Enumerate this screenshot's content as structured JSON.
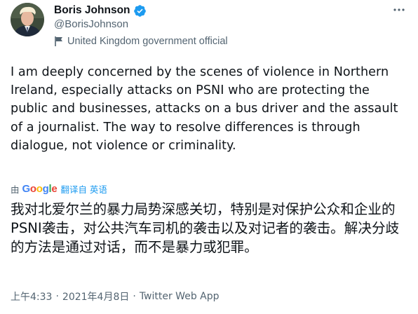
{
  "author": {
    "display_name": "Boris Johnson",
    "handle": "@BorisJohnson",
    "label": "United Kingdom government official",
    "avatar_icon": "profile-photo",
    "verified_icon": "verified-badge-icon",
    "label_icon": "flag-icon"
  },
  "tweet": {
    "text": "I am deeply concerned by the scenes of violence in Northern Ireland, especially attacks on PSNI who are protecting the public and businesses, attacks on a bus driver and the assault of a journalist. The way to resolve differences is through dialogue, not violence or criminality."
  },
  "translation": {
    "by": "由",
    "provider": "Google",
    "link": "翻译自 英语",
    "text": "我对北爱尔兰的暴力局势深感关切，特别是对保护公众和企业的PSNI袭击，对公共汽车司机的袭击以及对记者的袭击。解决分歧的方法是通过对话，而不是暴力或犯罪。"
  },
  "meta": {
    "time": "上午4:33",
    "separator": "·",
    "date": "2021年4月8日",
    "source": "Twitter Web App"
  },
  "colors": {
    "text": "#0f1419",
    "secondary": "#536471",
    "accent": "#1d9bf0"
  }
}
